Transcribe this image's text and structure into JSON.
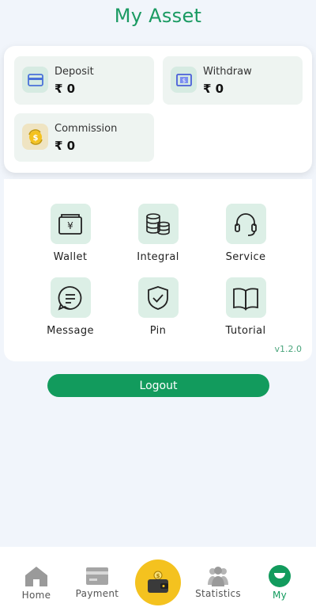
{
  "header": {
    "title": "My Asset"
  },
  "assets": {
    "deposit": {
      "label": "Deposit",
      "amount": "₹ 0"
    },
    "withdraw": {
      "label": "Withdraw",
      "amount": "₹ 0"
    },
    "commission": {
      "label": "Commission",
      "amount": "₹ 0"
    }
  },
  "menu": {
    "wallet": "Wallet",
    "integral": "Integral",
    "service": "Service",
    "message": "Message",
    "pin": "Pin",
    "tutorial": "Tutorial"
  },
  "version": "v1.2.0",
  "logout_label": "Logout",
  "tabs": {
    "home": "Home",
    "payment": "Payment",
    "statistics": "Statistics",
    "my": "My"
  },
  "colors": {
    "brand_green": "#1a9a62",
    "logout_green": "#129b5d",
    "center_button": "#f4c21f",
    "background": "#f1f5fb"
  }
}
